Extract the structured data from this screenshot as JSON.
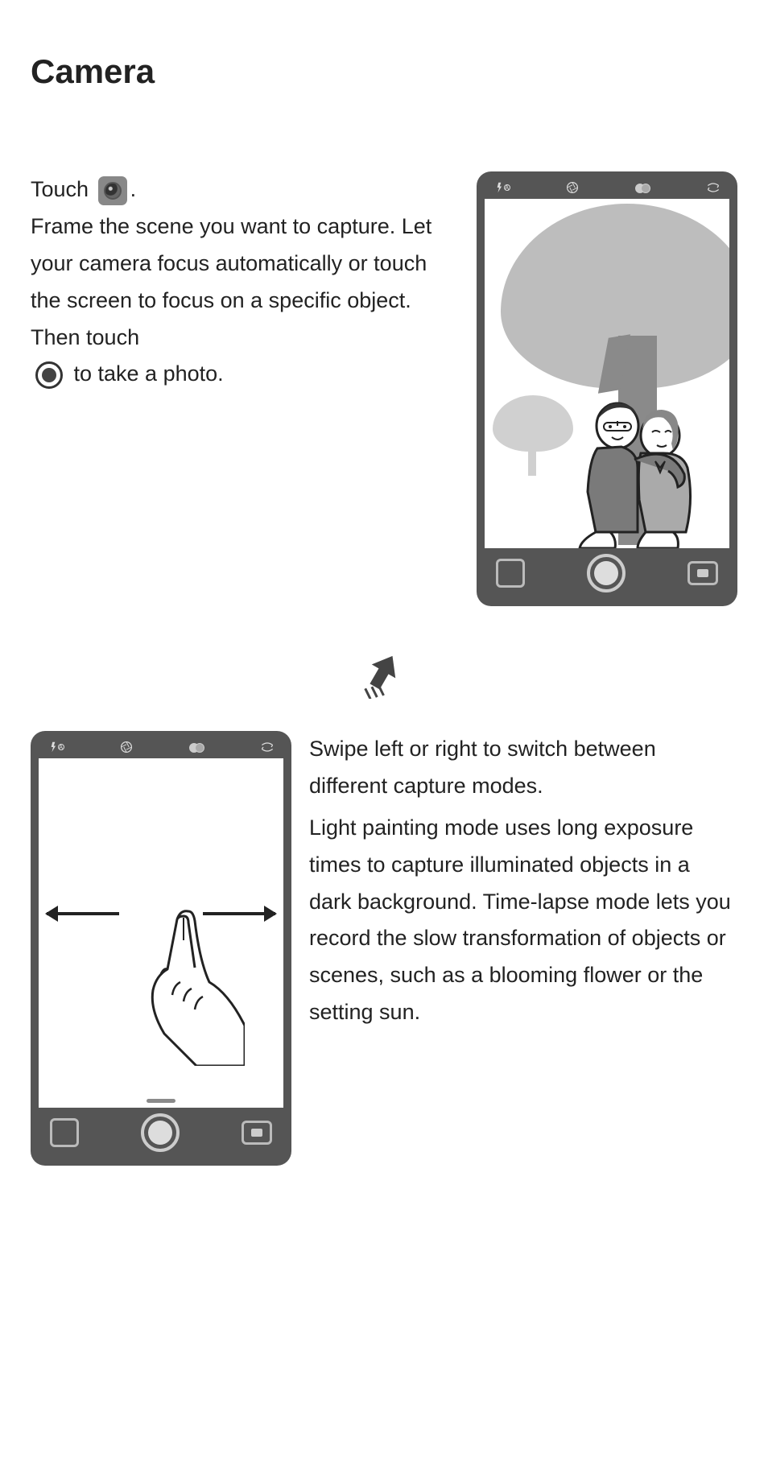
{
  "title": "Camera",
  "section1": {
    "touch_label": "Touch",
    "body1": "Frame the scene you want to capture. Let your camera focus automatically or touch the screen to focus on a specific object. Then touch",
    "tail": " to take a photo."
  },
  "section2": {
    "p1": "Swipe left or right to switch between different capture modes.",
    "p2": "Light painting mode uses long exposure times to capture illuminated objects in a dark background. Time-lapse mode lets you record the slow transformation of objects or scenes, such as a blooming flower or the setting sun."
  },
  "icons": {
    "camera_app": "camera-app-icon",
    "shutter": "shutter-icon",
    "flash": "flash-auto-icon",
    "aperture": "aperture-icon",
    "filter": "filter-icon",
    "switch": "switch-camera-icon",
    "gallery": "gallery-icon",
    "video": "video-icon"
  }
}
